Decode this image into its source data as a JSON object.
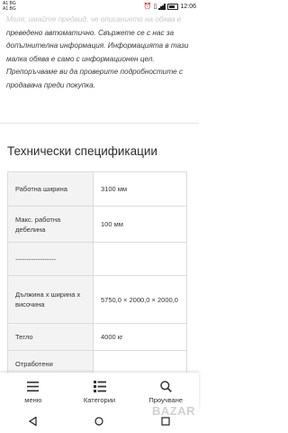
{
  "status_bar": {
    "carrier_1": "A1 BG",
    "carrier_2": "A1 BG",
    "battery": "",
    "time": "12:06"
  },
  "disclaimer": {
    "line_faded": "Моля, имайте предвид, че описанието на обява е",
    "text": "преведено автоматично. Свържете се с нас за допълнителна информация. Информацията в тази малка обява е само с информационен цел. Препоръчваме ви да проверите подробностите с продавача преди покупка."
  },
  "specs": {
    "title": "Технически спецификации",
    "rows": [
      {
        "label": "Работна ширина",
        "value": "3100 мм"
      },
      {
        "label": "Макс. работна дебелина",
        "value": "100 мм"
      },
      {
        "label": "------------------",
        "value": ""
      },
      {
        "label": "Дължина х ширина х височина",
        "value": "5750,0 × 2000,0 × 2000,0"
      },
      {
        "label": "Тегло",
        "value": "4000 кг"
      },
      {
        "label": "Отработени",
        "value": ""
      }
    ]
  },
  "bottom_nav": {
    "items": [
      {
        "label": "меню",
        "icon": "menu-icon"
      },
      {
        "label": "Категории",
        "icon": "categories-icon"
      },
      {
        "label": "Проучване",
        "icon": "search-icon"
      }
    ]
  },
  "watermark": "BAZAR"
}
